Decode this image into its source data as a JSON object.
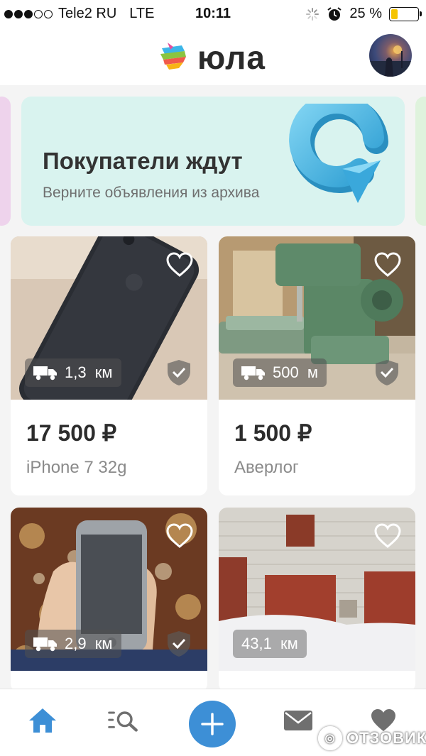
{
  "status_bar": {
    "carrier": "Tele2 RU",
    "network": "LTE",
    "time": "10:11",
    "battery": "25 %",
    "battery_color": "#f5c400"
  },
  "header": {
    "logo_text": "юла",
    "avatar": "user-avatar"
  },
  "banner": {
    "title": "Покупатели ждут",
    "subtitle": "Верните объявления из архива",
    "background": "#d9f3ef",
    "art_icon": "refresh-arrow-icon"
  },
  "listings": [
    {
      "price": "17 500 ₽",
      "title": "iPhone 7 32g",
      "distance": "1,3  км",
      "delivery": true,
      "verified": true
    },
    {
      "price": "1 500 ₽",
      "title": "Аверлог",
      "distance": "500  м",
      "delivery": true,
      "verified": true
    },
    {
      "price": "",
      "title": "",
      "distance": "2,9  км",
      "delivery": true,
      "verified": true
    },
    {
      "price": "",
      "title": "",
      "distance": "43,1  км",
      "delivery": false,
      "verified": false
    }
  ],
  "tabbar": {
    "items": [
      "home-icon",
      "search-list-icon",
      "add-icon",
      "mail-icon",
      "heart-icon"
    ],
    "active": "home-icon",
    "accent": "#3d8fd6"
  },
  "watermark": "ОТЗОВИК"
}
